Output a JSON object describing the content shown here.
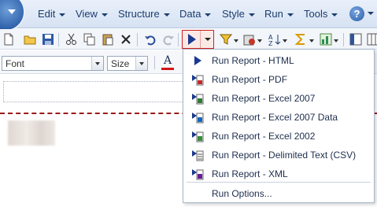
{
  "menu": {
    "items": [
      {
        "label": "Edit"
      },
      {
        "label": "View"
      },
      {
        "label": "Structure"
      },
      {
        "label": "Data"
      },
      {
        "label": "Style"
      },
      {
        "label": "Run"
      },
      {
        "label": "Tools"
      }
    ],
    "help_label": "?"
  },
  "format_bar": {
    "font_value": "Font",
    "size_value": "Size",
    "font_color_label": "A",
    "font_color": "#d4141c"
  },
  "run_menu": {
    "items": [
      {
        "label": "Run Report - HTML",
        "icon": "run-html-icon"
      },
      {
        "label": "Run Report - PDF",
        "icon": "pdf-report-icon"
      },
      {
        "label": "Run Report - Excel 2007",
        "icon": "excel-report-icon"
      },
      {
        "label": "Run Report - Excel 2007 Data",
        "icon": "excel-data-report-icon"
      },
      {
        "label": "Run Report - Excel 2002",
        "icon": "excel-report-icon"
      },
      {
        "label": "Run Report - Delimited Text (CSV)",
        "icon": "csv-report-icon"
      },
      {
        "label": "Run Report - XML",
        "icon": "xml-report-icon"
      }
    ],
    "options_label": "Run Options..."
  },
  "colors": {
    "accent": "#1b3a8f",
    "highlight_border": "#d02020",
    "divider_dash": "#9a1b1b"
  }
}
